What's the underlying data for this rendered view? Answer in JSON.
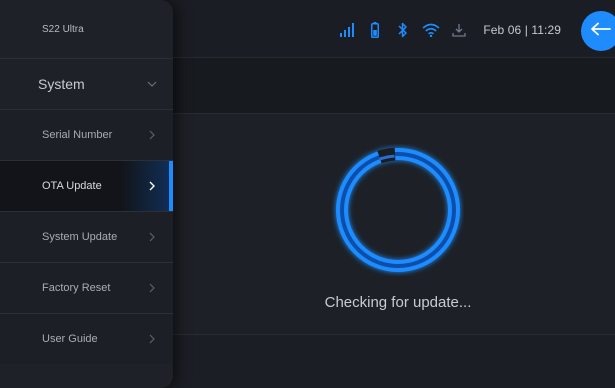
{
  "device": {
    "name": "S22 Ultra"
  },
  "sidebar": {
    "section_label": "System",
    "items": [
      {
        "label": "Serial Number"
      },
      {
        "label": "OTA Update",
        "active": true
      },
      {
        "label": "System Update"
      },
      {
        "label": "Factory Reset"
      },
      {
        "label": "User Guide"
      }
    ]
  },
  "statusbar": {
    "icons": [
      "signal-icon",
      "battery-icon",
      "bluetooth-icon",
      "wifi-icon",
      "download-icon"
    ],
    "datetime": "Feb 06 | 11:29"
  },
  "main": {
    "status_text": "Checking for update..."
  },
  "colors": {
    "accent": "#1e8cff",
    "background": "#1b1e24",
    "sidebar": "#1e2127"
  }
}
